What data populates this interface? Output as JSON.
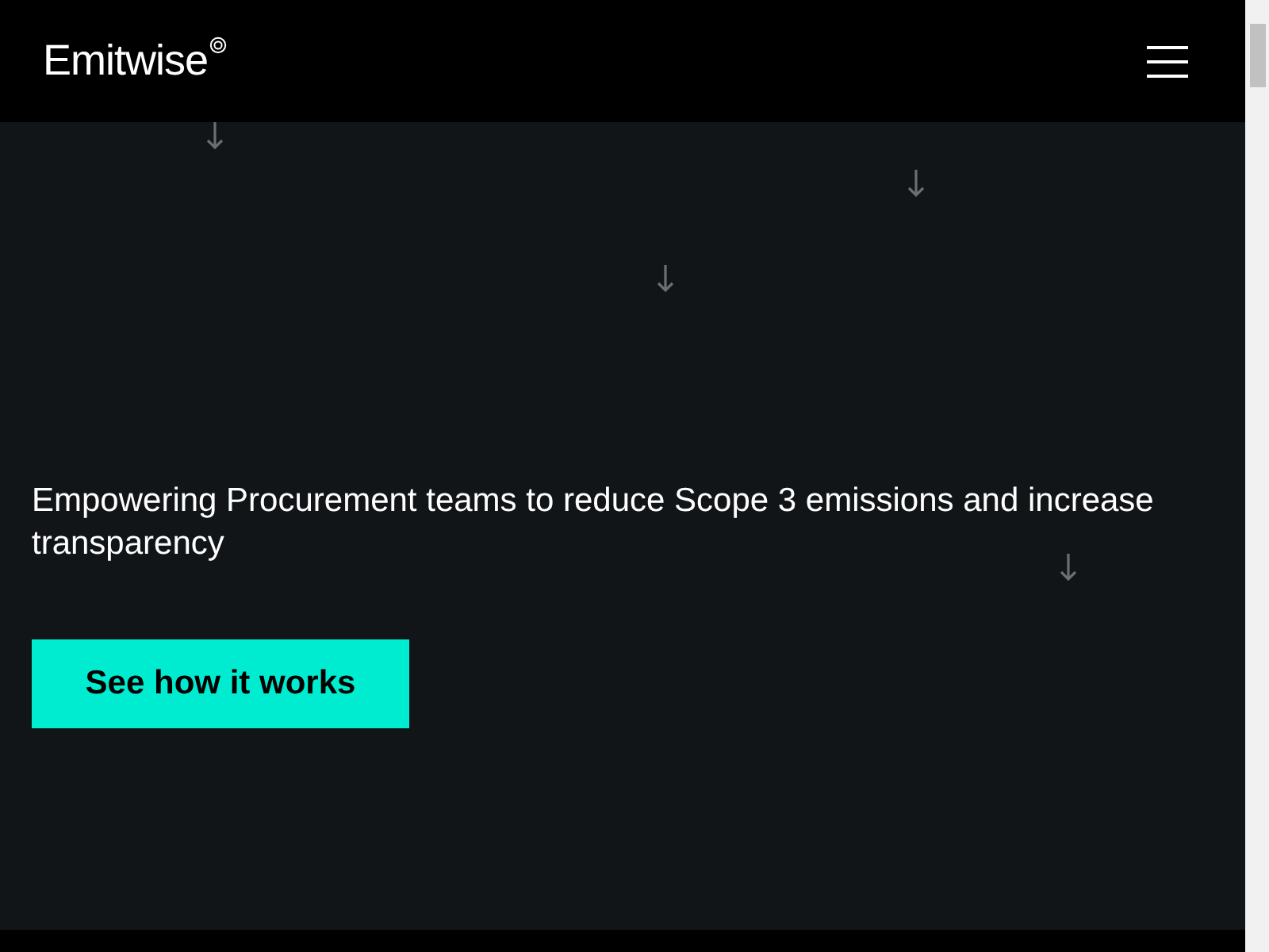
{
  "header": {
    "logo": "Emitwise"
  },
  "hero": {
    "headline": "Empowering Procurement teams to reduce Scope 3 emissions and increase transparency",
    "button": "See how it works"
  }
}
